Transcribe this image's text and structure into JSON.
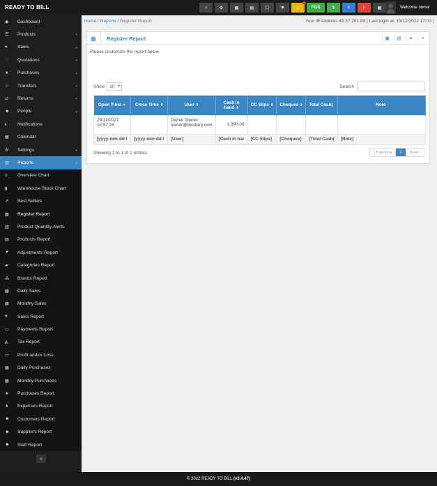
{
  "brand": "READY TO BILL",
  "topbar": {
    "pos_label": "POS",
    "welcome": "Welcome owner"
  },
  "sidebar": {
    "items": [
      {
        "label": "Dashboard",
        "icon": "dashboard-icon",
        "glyph": "◉",
        "chev": false
      },
      {
        "label": "Products",
        "icon": "barcode-icon",
        "glyph": "☰",
        "chev": true
      },
      {
        "label": "Sales",
        "icon": "heart-icon",
        "glyph": "♥",
        "chev": true
      },
      {
        "label": "Quotations",
        "icon": "heart-outline-icon",
        "glyph": "♡",
        "chev": true
      },
      {
        "label": "Purchases",
        "icon": "star-icon",
        "glyph": "★",
        "chev": true
      },
      {
        "label": "Transfers",
        "icon": "star-outline-icon",
        "glyph": "☆",
        "chev": true
      },
      {
        "label": "Returns",
        "icon": "random-icon",
        "glyph": "⇄",
        "chev": true
      },
      {
        "label": "People",
        "icon": "users-icon",
        "glyph": "☻",
        "chev": true
      },
      {
        "label": "Notifications",
        "icon": "info-icon",
        "glyph": "ℹ",
        "chev": false
      },
      {
        "label": "Calendar",
        "icon": "calendar-icon",
        "glyph": "▦",
        "chev": false
      },
      {
        "label": "Settings",
        "icon": "cog-icon",
        "glyph": "✲",
        "chev": true
      }
    ],
    "reports_label": "Reports",
    "sub_items": [
      {
        "label": "Overview Chart",
        "icon": "bars-icon",
        "glyph": "≡"
      },
      {
        "label": "Warehouse Stock Chart",
        "icon": "building-icon",
        "glyph": "▮"
      },
      {
        "label": "Best Sellers",
        "icon": "line-chart-icon",
        "glyph": "↗"
      },
      {
        "label": "Register Report",
        "icon": "th-large-icon",
        "glyph": "▦",
        "active": true
      },
      {
        "label": "Product Quantity Alerts",
        "icon": "bar-chart-icon",
        "glyph": "▥"
      },
      {
        "label": "Products Report",
        "icon": "barcode-icon",
        "glyph": "▤"
      },
      {
        "label": "Adjustments Report",
        "icon": "filter-icon",
        "glyph": "▼"
      },
      {
        "label": "Categories Report",
        "icon": "folder-open-icon",
        "glyph": "▰"
      },
      {
        "label": "Brands Report",
        "icon": "cubes-icon",
        "glyph": "⁂"
      },
      {
        "label": "Daily Sales",
        "icon": "calendar-icon",
        "glyph": "▦"
      },
      {
        "label": "Monthly Sales",
        "icon": "calendar-icon",
        "glyph": "▦"
      },
      {
        "label": "Sales Report",
        "icon": "heart-icon",
        "glyph": "♥"
      },
      {
        "label": "Payments Report",
        "icon": "money-icon",
        "glyph": "▭"
      },
      {
        "label": "Tax Report",
        "icon": "area-chart-icon",
        "glyph": "◭"
      },
      {
        "label": "Profit and/or Loss",
        "icon": "money-icon",
        "glyph": "▭"
      },
      {
        "label": "Daily Purchases",
        "icon": "calendar-icon",
        "glyph": "▦"
      },
      {
        "label": "Monthly Purchases",
        "icon": "calendar-icon",
        "glyph": "▦"
      },
      {
        "label": "Purchases Report",
        "icon": "star-icon",
        "glyph": "★"
      },
      {
        "label": "Expenses Report",
        "icon": "star-icon",
        "glyph": "★"
      },
      {
        "label": "Customers Report",
        "icon": "users-icon",
        "glyph": "☻"
      },
      {
        "label": "Suppliers Report",
        "icon": "users-icon",
        "glyph": "☻"
      },
      {
        "label": "Staff Report",
        "icon": "users-icon",
        "glyph": "☻"
      }
    ],
    "collapse_glyph": "«"
  },
  "breadcrumb": {
    "home": "Home",
    "reports": "Reports",
    "current": "Register Report"
  },
  "ip_info": "Your IP Address 49.37.201.89 ( Last login at: 15/12/2022 17:03 )",
  "card": {
    "title": "Register Report",
    "intro": "Please customize the report below",
    "show_label": "Show",
    "show_value": "10",
    "search_label": "Search"
  },
  "table": {
    "headers": [
      {
        "label": "Open Time",
        "arrow": "▼"
      },
      {
        "label": "Close Time",
        "arrow": "⇕"
      },
      {
        "label": "User",
        "arrow": "⇕"
      },
      {
        "label": "Cash in hand",
        "arrow": "⇕"
      },
      {
        "label": "CC Slips",
        "arrow": "⇕"
      },
      {
        "label": "Cheques",
        "arrow": "⇕"
      },
      {
        "label": "Total Cash(",
        "arrow": ""
      },
      {
        "label": "Note",
        "arrow": ""
      }
    ],
    "rows": [
      {
        "open_time": "29/11/2021 12:57:25",
        "close_time": "",
        "user_name": "Owner Owner",
        "user_email": "owner@tecdiary.com",
        "cash": "1,990.00",
        "cc": "",
        "cheques": "",
        "total": "",
        "note": ""
      }
    ],
    "filters": [
      "[yyyy-mm-dd I",
      "[yyyy-mm-dd I",
      "[User]",
      "[Cash in har",
      "[CC Slips]",
      "[Cheques]",
      "[Total Cash(",
      "[Note]"
    ]
  },
  "entries_info": "Showing 1 to 1 of 1 entries",
  "pager": {
    "prev": "‹ Previous",
    "page": "1",
    "next": "Next ›"
  },
  "footer": {
    "text": "© 2022 READY TO BILL ",
    "version": "(v3.4.47)"
  },
  "colors": {
    "accent": "#3c86c4",
    "active": "#5ab8e0",
    "dark": "#1b1b1b"
  }
}
